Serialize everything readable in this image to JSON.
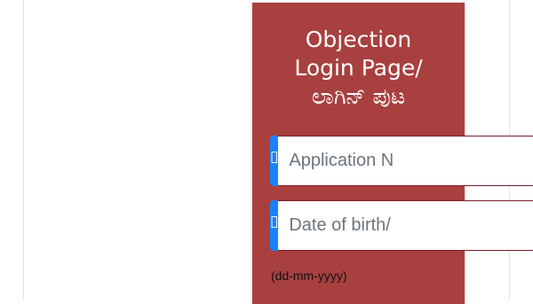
{
  "login_card": {
    "title_line1": "Objection",
    "title_line2": "Login Page/",
    "title_line3": "ಲಾಗಿನ್ ಪುಟ",
    "application_field": {
      "icon": "broken-glyph-icon",
      "icon_glyph": "▯",
      "placeholder": "Application N"
    },
    "dob_field": {
      "icon": "broken-glyph-icon",
      "icon_glyph": "▯",
      "placeholder": "Date of birth/"
    },
    "dob_format_hint": "(dd-mm-yyyy)"
  },
  "colors": {
    "card_background": "#a8403f",
    "addon_blue": "#1a82ff",
    "field_border": "#7a1d28"
  }
}
